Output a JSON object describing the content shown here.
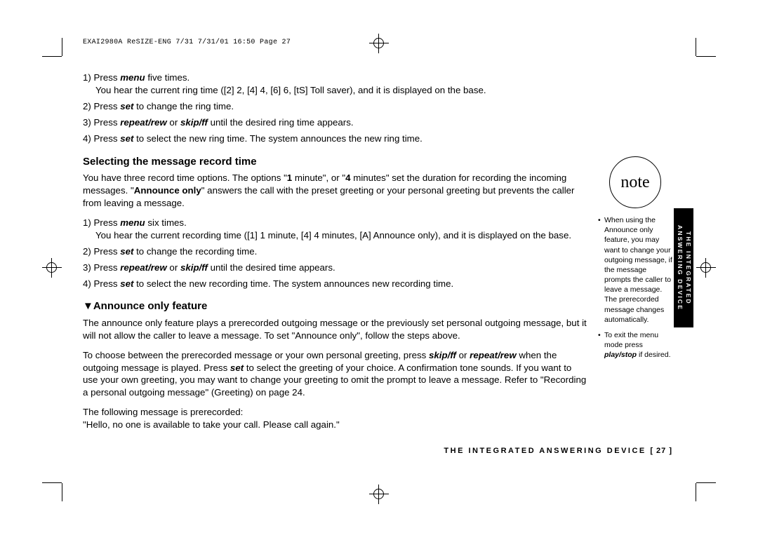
{
  "header": "EXAI2980A ReSIZE-ENG 7/31  7/31/01  16:50  Page 27",
  "step1a": "1) Press ",
  "step1b": "menu",
  "step1c": " five times.",
  "step1_sub": "You hear the current ring time ([2] 2, [4] 4, [6] 6, [tS] Toll saver), and it is displayed on the base.",
  "step2a": "2) Press ",
  "step2b": "set",
  "step2c": " to change the ring time.",
  "step3a": "3) Press ",
  "step3b": "repeat/rew",
  "step3c": " or ",
  "step3d": "skip/ff",
  "step3e": " until the desired ring time appears.",
  "step4a": "4) Press ",
  "step4b": "set",
  "step4c": " to select the new ring time. The system announces the new ring time.",
  "h2_1": "Selecting the message record time",
  "p1a": "You have three record time options. The options \"",
  "p1b": "1",
  "p1c": " minute\", or \"",
  "p1d": "4",
  "p1e": " minutes\" set the duration for recording the incoming messages. \"",
  "p1f": "Announce only",
  "p1g": "\" answers the call with the preset greeting or your personal greeting but prevents the caller from leaving a message.",
  "s1a": "1) Press ",
  "s1b": "menu",
  "s1c": " six times.",
  "s1_sub": "You hear the current recording time ([1] 1 minute, [4] 4 minutes, [A] Announce only), and it is displayed on the base.",
  "s2a": "2) Press ",
  "s2b": "set",
  "s2c": " to change the recording time.",
  "s3a": "3) Press ",
  "s3b": "repeat/rew",
  "s3c": " or ",
  "s3d": "skip/ff",
  "s3e": " until the desired time appears.",
  "s4a": "4) Press ",
  "s4b": "set",
  "s4c": " to select the new recording time. The system announces new recording time.",
  "h2_2": "▼Announce only feature",
  "p2": "The announce only feature plays a prerecorded outgoing message or the previously set personal outgoing message, but it will not allow the caller to leave a message. To set \"Announce only\", follow the steps above.",
  "p3a": "To choose between the prerecorded message or your own personal greeting, press ",
  "p3b": "skip/ff",
  "p3c": " or ",
  "p3d": "repeat/rew",
  "p3e": " when the outgoing message is played. Press ",
  "p3f": "set",
  "p3g": " to select the greeting of your choice. A confirmation tone sounds. If you want to use your own greeting, you may want to change your greeting to omit the prompt to leave a message. Refer to \"Recording a personal outgoing message\" (Greeting) on page 24.",
  "p4": "The following message is prerecorded:",
  "p5": "\"Hello, no one is available to take your call. Please call again.\"",
  "note_label": "note",
  "note1": "When using the Announce only feature, you may want to change your outgoing message, if the message prompts the caller to leave a message. The prerecorded message changes automatically.",
  "note2a": "To exit the menu mode press ",
  "note2b": "play/stop",
  "note2c": " if desired.",
  "tab_line1": "THE INTEGRATED",
  "tab_line2": "ANSWERING DEVICE",
  "footer_text": "THE INTEGRATED ANSWERING DEVICE ",
  "footer_pg": "[ 27 ]"
}
